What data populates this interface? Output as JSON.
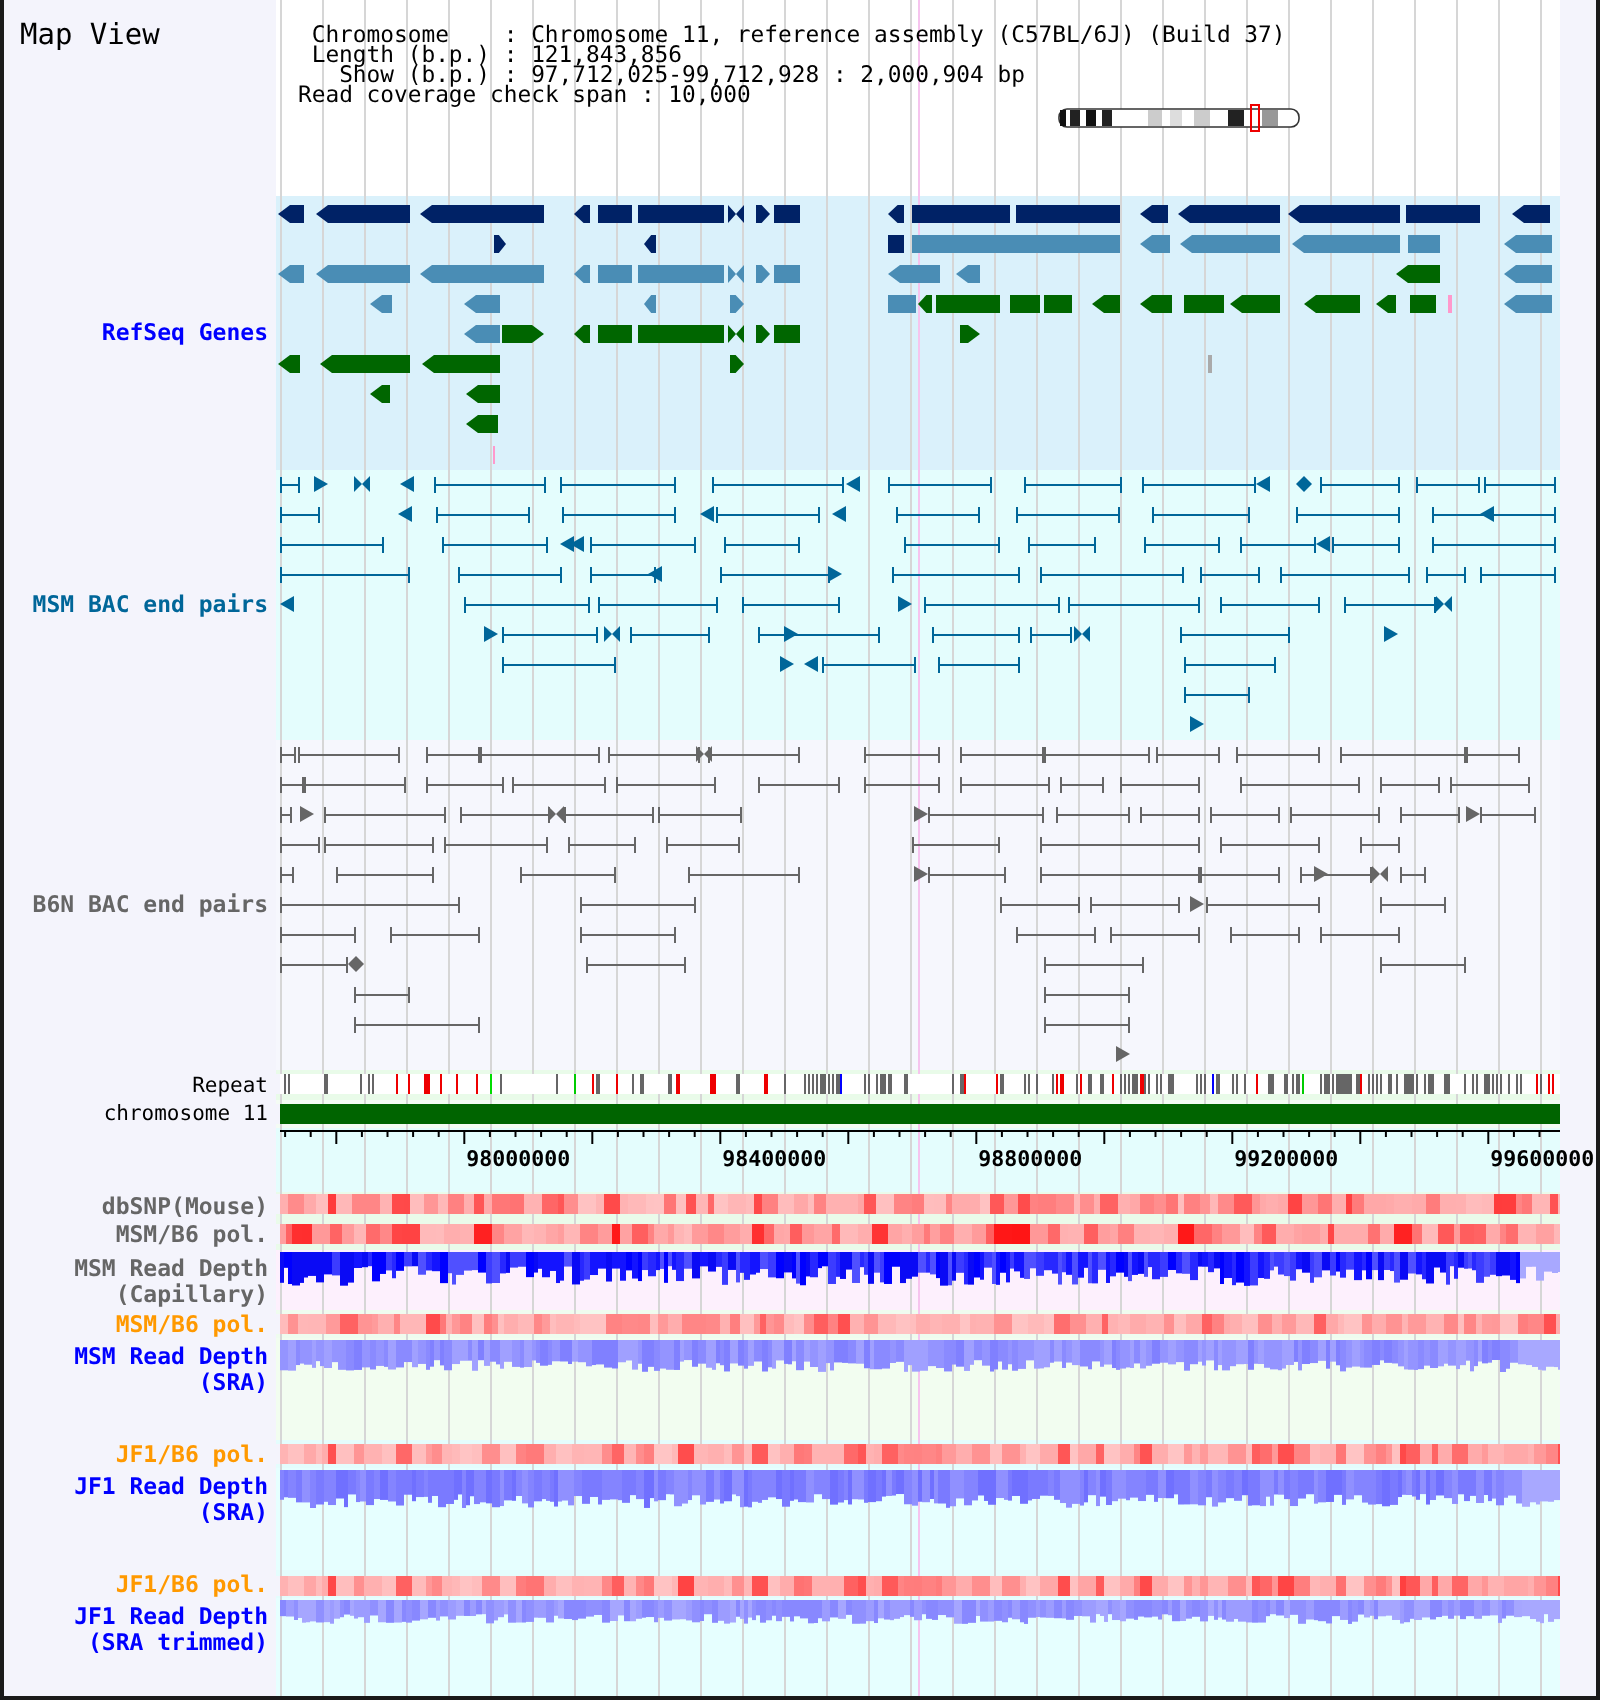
{
  "header": {
    "title": "Map View",
    "info_lines": [
      "Chromosome    : Chromosome 11, reference assembly (C57BL/6J) (Build 37)",
      "Length (b.p.) : 121,843,856",
      "Show (b.p.) : 97,712,025-99,712,928 : 2,000,904 bp",
      "Read coverage check span : 10,000"
    ]
  },
  "tracks": [
    {
      "kind": "genes",
      "label_lines": [
        "RefSeq Genes"
      ],
      "color": "#0000ff"
    },
    {
      "kind": "bac_pairs",
      "label_lines": [
        "MSM BAC end pairs"
      ],
      "color": "#006699"
    },
    {
      "kind": "bac_pairs",
      "label_lines": [
        "B6N BAC end pairs"
      ],
      "color": "#666666"
    },
    {
      "kind": "repeat",
      "label_lines": [
        "Repeat"
      ],
      "color": "#000000"
    },
    {
      "kind": "chromosome",
      "label_lines": [
        "chromosome 11"
      ],
      "color": "#000000"
    },
    {
      "kind": "ruler",
      "ticks": [
        "98000000",
        "98400000",
        "98800000",
        "99200000",
        "99600000"
      ]
    },
    {
      "kind": "heat",
      "label_lines": [
        "dbSNP(Mouse)"
      ],
      "color": "#666666"
    },
    {
      "kind": "heat",
      "label_lines": [
        "MSM/B6 pol."
      ],
      "color": "#666666"
    },
    {
      "kind": "depth",
      "label_lines": [
        "MSM Read Depth",
        "(Capillary)"
      ],
      "color": "#666666"
    },
    {
      "kind": "heat",
      "label_lines": [
        "MSM/B6 pol."
      ],
      "color": "#ff9900"
    },
    {
      "kind": "depth",
      "label_lines": [
        "MSM Read Depth",
        "(SRA)"
      ],
      "color": "#0000ff"
    },
    {
      "kind": "heat",
      "label_lines": [
        "JF1/B6 pol."
      ],
      "color": "#ff9900"
    },
    {
      "kind": "depth",
      "label_lines": [
        "JF1 Read Depth",
        "(SRA)"
      ],
      "color": "#0000ff"
    },
    {
      "kind": "heat",
      "label_lines": [
        "JF1/B6 pol."
      ],
      "color": "#ff9900"
    },
    {
      "kind": "depth",
      "label_lines": [
        "JF1 Read Depth",
        "(SRA trimmed)"
      ],
      "color": "#0000ff"
    }
  ]
}
